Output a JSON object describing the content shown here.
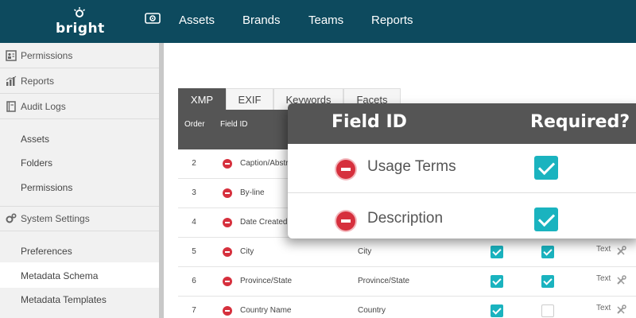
{
  "brand": {
    "name": "bright"
  },
  "nav": {
    "items": [
      "Assets",
      "Brands",
      "Teams",
      "Reports"
    ]
  },
  "sidebar": {
    "sections": [
      {
        "label": "Permissions",
        "icon": "id-card-icon"
      },
      {
        "label": "Reports",
        "icon": "bar-chart-icon"
      },
      {
        "label": "Audit Logs",
        "icon": "log-book-icon"
      }
    ],
    "audit_items": [
      "Assets",
      "Folders",
      "Permissions"
    ],
    "system_settings": {
      "label": "System Settings",
      "icon": "gears-icon"
    },
    "settings_items": [
      "Preferences",
      "Metadata Schema",
      "Metadata Templates"
    ],
    "active_item": "Metadata Schema"
  },
  "tabs": {
    "items": [
      "XMP",
      "EXIF",
      "Keywords",
      "Facets"
    ],
    "active": "XMP"
  },
  "table": {
    "headers": {
      "order": "Order",
      "field_id": "Field ID"
    },
    "rows": [
      {
        "order": "2",
        "field": "Caption/Abstr"
      },
      {
        "order": "3",
        "field": "By-line"
      },
      {
        "order": "4",
        "field": "Date Created"
      },
      {
        "order": "5",
        "field": "City",
        "label": "City",
        "check1": true,
        "check2": true,
        "type": "Text"
      },
      {
        "order": "6",
        "field": "Province/State",
        "label": "Province/State",
        "check1": true,
        "check2": true,
        "type": "Text"
      },
      {
        "order": "7",
        "field": "Country Name",
        "label": "Country",
        "check1": true,
        "check2": false,
        "type": "Text"
      }
    ]
  },
  "zoom": {
    "headers": {
      "field_id": "Field ID",
      "required": "Required?"
    },
    "rows": [
      {
        "field": "Usage Terms",
        "required": true
      },
      {
        "field": "Description",
        "required": true
      }
    ]
  },
  "colors": {
    "topbar": "#0d4a5e",
    "accent": "#1ab3bf",
    "remove": "#d6303d",
    "header": "#555555"
  }
}
